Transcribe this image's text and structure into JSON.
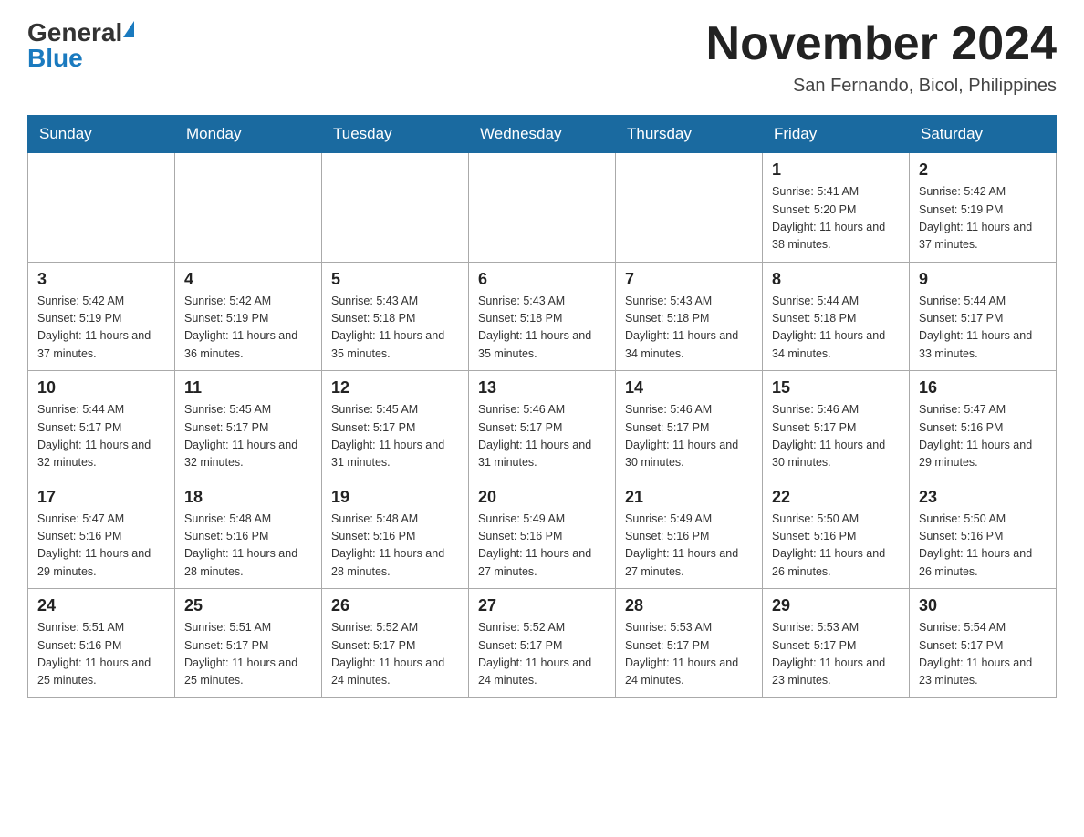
{
  "logo": {
    "general": "General",
    "blue": "Blue"
  },
  "header": {
    "month_year": "November 2024",
    "location": "San Fernando, Bicol, Philippines"
  },
  "weekdays": [
    "Sunday",
    "Monday",
    "Tuesday",
    "Wednesday",
    "Thursday",
    "Friday",
    "Saturday"
  ],
  "weeks": [
    {
      "days": [
        {
          "num": "",
          "info": ""
        },
        {
          "num": "",
          "info": ""
        },
        {
          "num": "",
          "info": ""
        },
        {
          "num": "",
          "info": ""
        },
        {
          "num": "",
          "info": ""
        },
        {
          "num": "1",
          "info": "Sunrise: 5:41 AM\nSunset: 5:20 PM\nDaylight: 11 hours and 38 minutes."
        },
        {
          "num": "2",
          "info": "Sunrise: 5:42 AM\nSunset: 5:19 PM\nDaylight: 11 hours and 37 minutes."
        }
      ]
    },
    {
      "days": [
        {
          "num": "3",
          "info": "Sunrise: 5:42 AM\nSunset: 5:19 PM\nDaylight: 11 hours and 37 minutes."
        },
        {
          "num": "4",
          "info": "Sunrise: 5:42 AM\nSunset: 5:19 PM\nDaylight: 11 hours and 36 minutes."
        },
        {
          "num": "5",
          "info": "Sunrise: 5:43 AM\nSunset: 5:18 PM\nDaylight: 11 hours and 35 minutes."
        },
        {
          "num": "6",
          "info": "Sunrise: 5:43 AM\nSunset: 5:18 PM\nDaylight: 11 hours and 35 minutes."
        },
        {
          "num": "7",
          "info": "Sunrise: 5:43 AM\nSunset: 5:18 PM\nDaylight: 11 hours and 34 minutes."
        },
        {
          "num": "8",
          "info": "Sunrise: 5:44 AM\nSunset: 5:18 PM\nDaylight: 11 hours and 34 minutes."
        },
        {
          "num": "9",
          "info": "Sunrise: 5:44 AM\nSunset: 5:17 PM\nDaylight: 11 hours and 33 minutes."
        }
      ]
    },
    {
      "days": [
        {
          "num": "10",
          "info": "Sunrise: 5:44 AM\nSunset: 5:17 PM\nDaylight: 11 hours and 32 minutes."
        },
        {
          "num": "11",
          "info": "Sunrise: 5:45 AM\nSunset: 5:17 PM\nDaylight: 11 hours and 32 minutes."
        },
        {
          "num": "12",
          "info": "Sunrise: 5:45 AM\nSunset: 5:17 PM\nDaylight: 11 hours and 31 minutes."
        },
        {
          "num": "13",
          "info": "Sunrise: 5:46 AM\nSunset: 5:17 PM\nDaylight: 11 hours and 31 minutes."
        },
        {
          "num": "14",
          "info": "Sunrise: 5:46 AM\nSunset: 5:17 PM\nDaylight: 11 hours and 30 minutes."
        },
        {
          "num": "15",
          "info": "Sunrise: 5:46 AM\nSunset: 5:17 PM\nDaylight: 11 hours and 30 minutes."
        },
        {
          "num": "16",
          "info": "Sunrise: 5:47 AM\nSunset: 5:16 PM\nDaylight: 11 hours and 29 minutes."
        }
      ]
    },
    {
      "days": [
        {
          "num": "17",
          "info": "Sunrise: 5:47 AM\nSunset: 5:16 PM\nDaylight: 11 hours and 29 minutes."
        },
        {
          "num": "18",
          "info": "Sunrise: 5:48 AM\nSunset: 5:16 PM\nDaylight: 11 hours and 28 minutes."
        },
        {
          "num": "19",
          "info": "Sunrise: 5:48 AM\nSunset: 5:16 PM\nDaylight: 11 hours and 28 minutes."
        },
        {
          "num": "20",
          "info": "Sunrise: 5:49 AM\nSunset: 5:16 PM\nDaylight: 11 hours and 27 minutes."
        },
        {
          "num": "21",
          "info": "Sunrise: 5:49 AM\nSunset: 5:16 PM\nDaylight: 11 hours and 27 minutes."
        },
        {
          "num": "22",
          "info": "Sunrise: 5:50 AM\nSunset: 5:16 PM\nDaylight: 11 hours and 26 minutes."
        },
        {
          "num": "23",
          "info": "Sunrise: 5:50 AM\nSunset: 5:16 PM\nDaylight: 11 hours and 26 minutes."
        }
      ]
    },
    {
      "days": [
        {
          "num": "24",
          "info": "Sunrise: 5:51 AM\nSunset: 5:16 PM\nDaylight: 11 hours and 25 minutes."
        },
        {
          "num": "25",
          "info": "Sunrise: 5:51 AM\nSunset: 5:17 PM\nDaylight: 11 hours and 25 minutes."
        },
        {
          "num": "26",
          "info": "Sunrise: 5:52 AM\nSunset: 5:17 PM\nDaylight: 11 hours and 24 minutes."
        },
        {
          "num": "27",
          "info": "Sunrise: 5:52 AM\nSunset: 5:17 PM\nDaylight: 11 hours and 24 minutes."
        },
        {
          "num": "28",
          "info": "Sunrise: 5:53 AM\nSunset: 5:17 PM\nDaylight: 11 hours and 24 minutes."
        },
        {
          "num": "29",
          "info": "Sunrise: 5:53 AM\nSunset: 5:17 PM\nDaylight: 11 hours and 23 minutes."
        },
        {
          "num": "30",
          "info": "Sunrise: 5:54 AM\nSunset: 5:17 PM\nDaylight: 11 hours and 23 minutes."
        }
      ]
    }
  ]
}
